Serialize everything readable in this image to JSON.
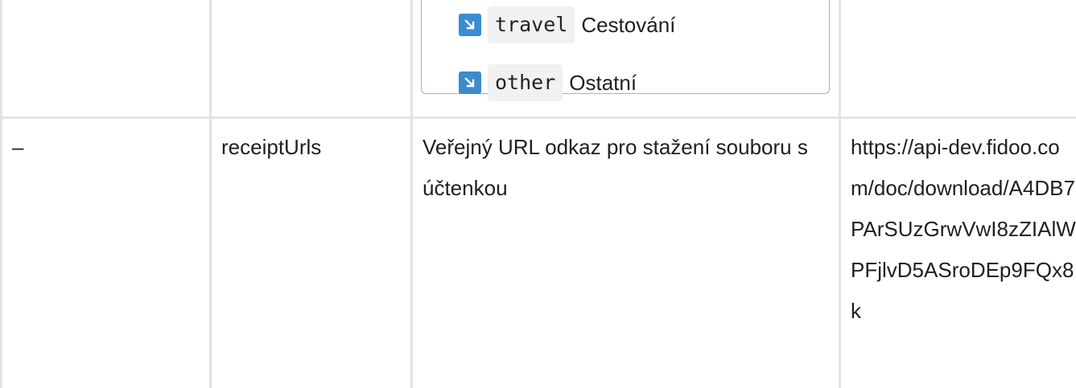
{
  "enum_items": [
    {
      "code": "travel",
      "label": "Cestování"
    },
    {
      "code": "other",
      "label": "Ostatní"
    }
  ],
  "row": {
    "dash": "–",
    "name": "receiptUrls",
    "description": "Veřejný URL odkaz pro stažení souboru s účtenkou",
    "example": "https://api-dev.fidoo.com/doc/download/A4DB7PArSUzGrwVwI8zZIAlWPFjlvD5ASroDEp9FQx8k"
  },
  "colors": {
    "grid": "#e3e3e3",
    "enum_border": "#8fb3dc",
    "icon_bg": "#3b8bd1",
    "code_bg": "#f1f1f1"
  },
  "icons": {
    "enum_marker": "arrow-down-right-icon"
  }
}
